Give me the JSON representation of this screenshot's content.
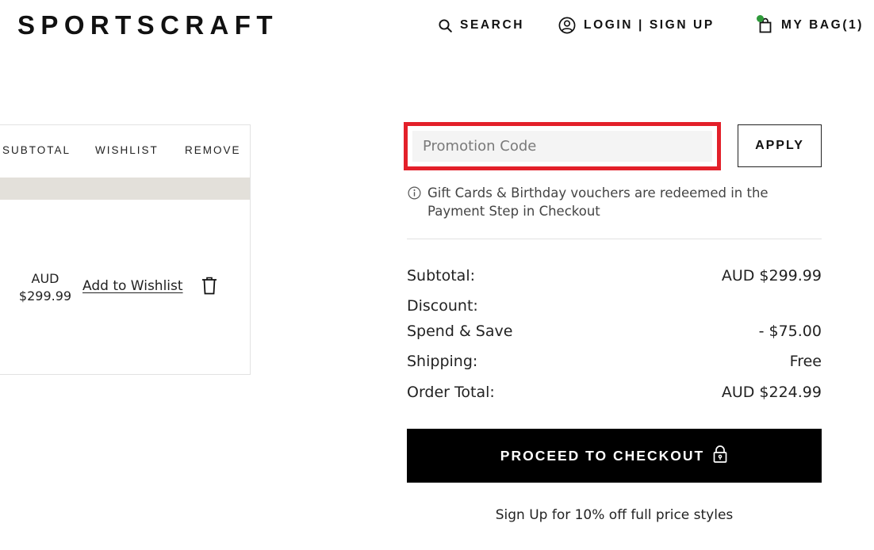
{
  "header": {
    "logo": "SPORTSCRAFT",
    "search_label": "SEARCH",
    "login_label": "LOGIN | SIGN UP",
    "bag_label": "MY BAG(1)",
    "bag_dot_color": "#2e9a3a"
  },
  "cart": {
    "columns": [
      "SUBTOTAL",
      "WISHLIST",
      "REMOVE"
    ],
    "item": {
      "currency": "AUD",
      "price": "$299.99",
      "wishlist_link": "Add to Wishlist"
    }
  },
  "promo": {
    "placeholder": "Promotion Code",
    "value": "",
    "apply_label": "APPLY",
    "highlight_color": "#e3202a",
    "note": "Gift Cards & Birthday vouchers are redeemed in the Payment Step in Checkout"
  },
  "summary": {
    "subtotal_label": "Subtotal:",
    "subtotal_value": "AUD $299.99",
    "discount_label": "Discount:",
    "spend_save_label": "Spend & Save",
    "spend_save_value": "- $75.00",
    "shipping_label": "Shipping:",
    "shipping_value": "Free",
    "total_label": "Order Total:",
    "total_value": "AUD $224.99"
  },
  "checkout": {
    "label": "PROCEED TO CHECKOUT",
    "signup_text": "Sign Up for 10% off full price styles"
  },
  "icons": {
    "search": "search-icon",
    "user": "user-circle-icon",
    "bag": "shopping-bag-icon",
    "info": "info-icon",
    "trash": "trash-icon",
    "lock": "lock-icon"
  }
}
